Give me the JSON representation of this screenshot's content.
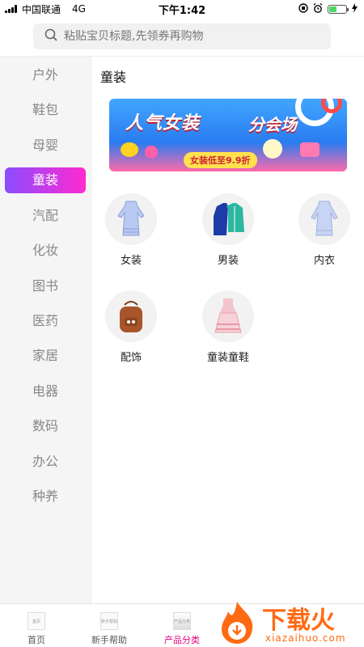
{
  "status_bar": {
    "carrier": "中国联通",
    "network": "4G",
    "time": "下午1:42",
    "battery_level": 0.45
  },
  "search": {
    "placeholder": "粘贴宝贝标题,先领券再购物"
  },
  "sidebar": {
    "items": [
      {
        "label": "户外",
        "active": false
      },
      {
        "label": "鞋包",
        "active": false
      },
      {
        "label": "母婴",
        "active": false
      },
      {
        "label": "童装",
        "active": true
      },
      {
        "label": "汽配",
        "active": false
      },
      {
        "label": "化妆",
        "active": false
      },
      {
        "label": "图书",
        "active": false
      },
      {
        "label": "医药",
        "active": false
      },
      {
        "label": "家居",
        "active": false
      },
      {
        "label": "电器",
        "active": false
      },
      {
        "label": "数码",
        "active": false
      },
      {
        "label": "办公",
        "active": false
      },
      {
        "label": "种养",
        "active": false
      }
    ]
  },
  "main": {
    "title": "童装",
    "banner": {
      "title_a": "人气女装",
      "title_b": "分会场",
      "strip": "女装低至9.9折"
    },
    "categories": [
      {
        "label": "女装",
        "icon": "dress-icon"
      },
      {
        "label": "男装",
        "icon": "jacket-icon"
      },
      {
        "label": "内衣",
        "icon": "blouse-icon"
      },
      {
        "label": "配饰",
        "icon": "backpack-icon"
      },
      {
        "label": "童装童鞋",
        "icon": "kids-dress-icon"
      }
    ]
  },
  "tabbar": {
    "tabs": [
      {
        "label": "首页",
        "icon_text": "首页",
        "active": false
      },
      {
        "label": "新手帮助",
        "icon_text": "新手帮助",
        "active": false
      },
      {
        "label": "产品分类",
        "icon_text": "产品分类",
        "active": true
      }
    ]
  },
  "watermark": {
    "brand": "下载火",
    "domain": "xiazaihuo.com"
  },
  "colors": {
    "accent_start": "#8a4dff",
    "accent_end": "#ff2ad0",
    "active_tab": "#e6007e",
    "watermark": "#ff6a13"
  }
}
